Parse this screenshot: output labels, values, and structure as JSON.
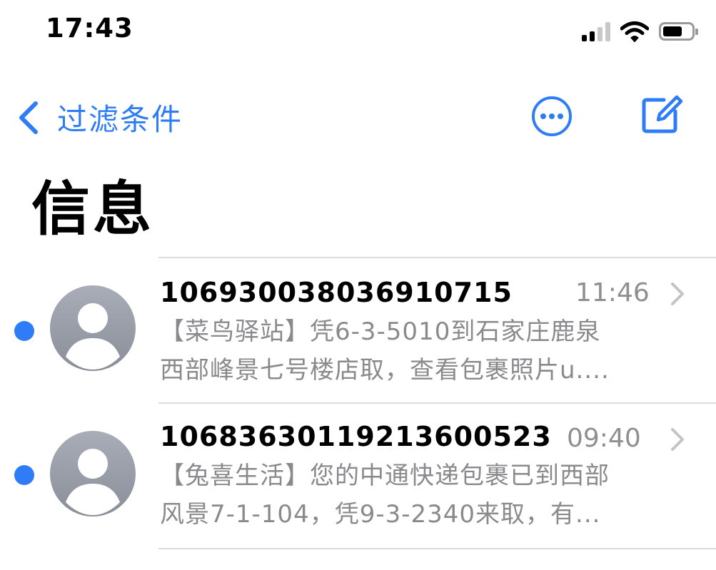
{
  "status_bar": {
    "time": "17:43",
    "signal_icon": "cellular-signal-icon",
    "wifi_icon": "wifi-icon",
    "battery_icon": "battery-icon",
    "battery_level": 0.6
  },
  "nav": {
    "back_label": "过滤条件",
    "back_icon": "chevron-left-icon",
    "more_icon": "ellipsis-circle-icon",
    "compose_icon": "compose-icon",
    "accent_color": "#2f7df6"
  },
  "title": "信息",
  "messages": [
    {
      "sender": "106930038036910715",
      "time": "11:46",
      "unread": true,
      "preview_line1": "【菜鸟驿站】凭6-3-5010到石家庄鹿泉",
      "preview_line2": "西部峰景七号楼店取，查看包裹照片u...."
    },
    {
      "sender": "1068363011921360052​3",
      "time": "09:40",
      "unread": true,
      "preview_line1": "【兔喜生活】您的中通快递包裹已到西部",
      "preview_line2": "风景7-1-104，凭9-3-2340来取，有..."
    }
  ]
}
